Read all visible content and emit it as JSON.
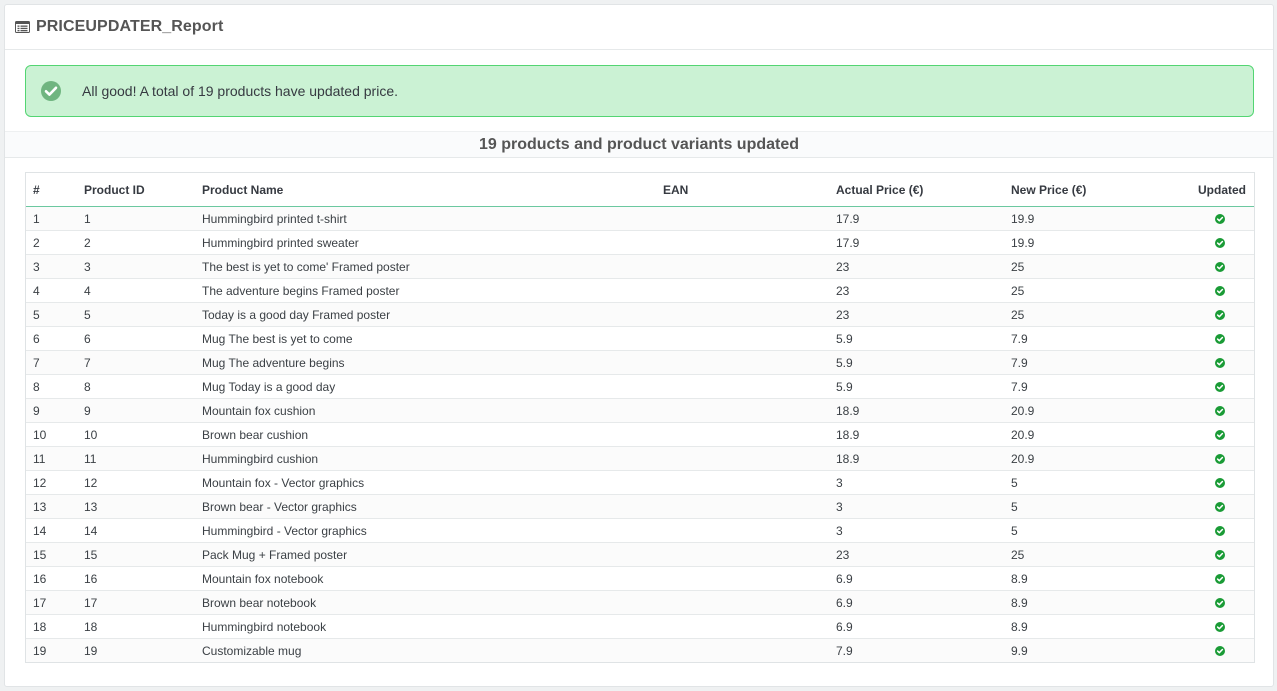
{
  "header": {
    "title": "PRICEUPDATER_Report",
    "icon": "list-alt-icon"
  },
  "alert": {
    "icon": "check-circle-icon",
    "text": "All good! A total of 19 products have updated price.",
    "colors": {
      "background": "#cbf2d4",
      "border": "#53d572",
      "icon": "#70b580"
    }
  },
  "section": {
    "title": "19 products and product variants updated"
  },
  "table": {
    "columns": [
      "#",
      "Product ID",
      "Product Name",
      "EAN",
      "Actual Price (€)",
      "New Price (€)",
      "Updated"
    ],
    "rows": [
      {
        "num": "1",
        "id": "1",
        "name": "Hummingbird printed t-shirt",
        "ean": "",
        "actual": "17.9",
        "new": "19.9",
        "updated": true
      },
      {
        "num": "2",
        "id": "2",
        "name": "Hummingbird printed sweater",
        "ean": "",
        "actual": "17.9",
        "new": "19.9",
        "updated": true
      },
      {
        "num": "3",
        "id": "3",
        "name": "The best is yet to come' Framed poster",
        "ean": "",
        "actual": "23",
        "new": "25",
        "updated": true
      },
      {
        "num": "4",
        "id": "4",
        "name": "The adventure begins Framed poster",
        "ean": "",
        "actual": "23",
        "new": "25",
        "updated": true
      },
      {
        "num": "5",
        "id": "5",
        "name": "Today is a good day Framed poster",
        "ean": "",
        "actual": "23",
        "new": "25",
        "updated": true
      },
      {
        "num": "6",
        "id": "6",
        "name": "Mug The best is yet to come",
        "ean": "",
        "actual": "5.9",
        "new": "7.9",
        "updated": true
      },
      {
        "num": "7",
        "id": "7",
        "name": "Mug The adventure begins",
        "ean": "",
        "actual": "5.9",
        "new": "7.9",
        "updated": true
      },
      {
        "num": "8",
        "id": "8",
        "name": "Mug Today is a good day",
        "ean": "",
        "actual": "5.9",
        "new": "7.9",
        "updated": true
      },
      {
        "num": "9",
        "id": "9",
        "name": "Mountain fox cushion",
        "ean": "",
        "actual": "18.9",
        "new": "20.9",
        "updated": true
      },
      {
        "num": "10",
        "id": "10",
        "name": "Brown bear cushion",
        "ean": "",
        "actual": "18.9",
        "new": "20.9",
        "updated": true
      },
      {
        "num": "11",
        "id": "11",
        "name": "Hummingbird cushion",
        "ean": "",
        "actual": "18.9",
        "new": "20.9",
        "updated": true
      },
      {
        "num": "12",
        "id": "12",
        "name": "Mountain fox - Vector graphics",
        "ean": "",
        "actual": "3",
        "new": "5",
        "updated": true
      },
      {
        "num": "13",
        "id": "13",
        "name": "Brown bear - Vector graphics",
        "ean": "",
        "actual": "3",
        "new": "5",
        "updated": true
      },
      {
        "num": "14",
        "id": "14",
        "name": "Hummingbird - Vector graphics",
        "ean": "",
        "actual": "3",
        "new": "5",
        "updated": true
      },
      {
        "num": "15",
        "id": "15",
        "name": "Pack Mug + Framed poster",
        "ean": "",
        "actual": "23",
        "new": "25",
        "updated": true
      },
      {
        "num": "16",
        "id": "16",
        "name": "Mountain fox notebook",
        "ean": "",
        "actual": "6.9",
        "new": "8.9",
        "updated": true
      },
      {
        "num": "17",
        "id": "17",
        "name": "Brown bear notebook",
        "ean": "",
        "actual": "6.9",
        "new": "8.9",
        "updated": true
      },
      {
        "num": "18",
        "id": "18",
        "name": "Hummingbird notebook",
        "ean": "",
        "actual": "6.9",
        "new": "8.9",
        "updated": true
      },
      {
        "num": "19",
        "id": "19",
        "name": "Customizable mug",
        "ean": "",
        "actual": "7.9",
        "new": "9.9",
        "updated": true
      }
    ],
    "updated_icon": "check-circle-icon",
    "updated_icon_color": "#1a9b36"
  }
}
